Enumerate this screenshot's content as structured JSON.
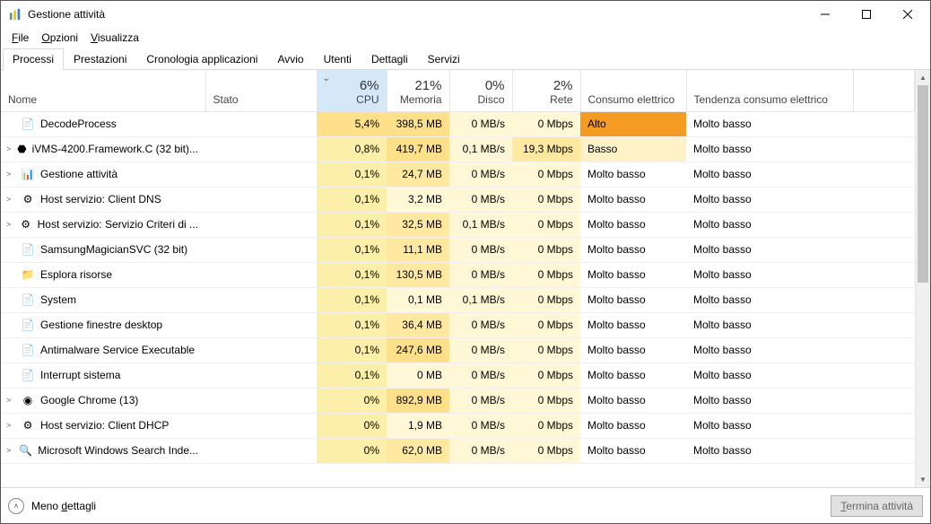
{
  "window": {
    "title": "Gestione attività"
  },
  "menu": {
    "file": "File",
    "options": "Opzioni",
    "view": "Visualizza"
  },
  "tabs": [
    "Processi",
    "Prestazioni",
    "Cronologia applicazioni",
    "Avvio",
    "Utenti",
    "Dettagli",
    "Servizi"
  ],
  "active_tab": 0,
  "columns": {
    "name": "Nome",
    "state": "Stato",
    "cpu": {
      "pct": "6%",
      "label": "CPU"
    },
    "mem": {
      "pct": "21%",
      "label": "Memoria"
    },
    "disk": {
      "pct": "0%",
      "label": "Disco"
    },
    "net": {
      "pct": "2%",
      "label": "Rete"
    },
    "power": "Consumo elettrico",
    "trend": "Tendenza consumo elettrico"
  },
  "rows": [
    {
      "exp": "",
      "icon": "app",
      "name": "DecodeProcess",
      "cpu": "5,4%",
      "mem": "398,5 MB",
      "disk": "0 MB/s",
      "net": "0 Mbps",
      "power": "Alto",
      "trend": "Molto basso",
      "pc": "alto"
    },
    {
      "exp": ">",
      "icon": "hik",
      "name": "iVMS-4200.Framework.C (32 bit)...",
      "cpu": "0,8%",
      "mem": "419,7 MB",
      "disk": "0,1 MB/s",
      "net": "19,3 Mbps",
      "power": "Basso",
      "trend": "Molto basso",
      "pc": "basso"
    },
    {
      "exp": ">",
      "icon": "tm",
      "name": "Gestione attività",
      "cpu": "0,1%",
      "mem": "24,7 MB",
      "disk": "0 MB/s",
      "net": "0 Mbps",
      "power": "Molto basso",
      "trend": "Molto basso",
      "pc": ""
    },
    {
      "exp": ">",
      "icon": "svc",
      "name": "Host servizio: Client DNS",
      "cpu": "0,1%",
      "mem": "3,2 MB",
      "disk": "0 MB/s",
      "net": "0 Mbps",
      "power": "Molto basso",
      "trend": "Molto basso",
      "pc": ""
    },
    {
      "exp": ">",
      "icon": "svc",
      "name": "Host servizio: Servizio Criteri di ...",
      "cpu": "0,1%",
      "mem": "32,5 MB",
      "disk": "0,1 MB/s",
      "net": "0 Mbps",
      "power": "Molto basso",
      "trend": "Molto basso",
      "pc": ""
    },
    {
      "exp": "",
      "icon": "app",
      "name": "SamsungMagicianSVC (32 bit)",
      "cpu": "0,1%",
      "mem": "11,1 MB",
      "disk": "0 MB/s",
      "net": "0 Mbps",
      "power": "Molto basso",
      "trend": "Molto basso",
      "pc": ""
    },
    {
      "exp": "",
      "icon": "folder",
      "name": "Esplora risorse",
      "cpu": "0,1%",
      "mem": "130,5 MB",
      "disk": "0 MB/s",
      "net": "0 Mbps",
      "power": "Molto basso",
      "trend": "Molto basso",
      "pc": ""
    },
    {
      "exp": "",
      "icon": "app",
      "name": "System",
      "cpu": "0,1%",
      "mem": "0,1 MB",
      "disk": "0,1 MB/s",
      "net": "0 Mbps",
      "power": "Molto basso",
      "trend": "Molto basso",
      "pc": ""
    },
    {
      "exp": "",
      "icon": "app",
      "name": "Gestione finestre desktop",
      "cpu": "0,1%",
      "mem": "36,4 MB",
      "disk": "0 MB/s",
      "net": "0 Mbps",
      "power": "Molto basso",
      "trend": "Molto basso",
      "pc": ""
    },
    {
      "exp": "",
      "icon": "app",
      "name": "Antimalware Service Executable",
      "cpu": "0,1%",
      "mem": "247,6 MB",
      "disk": "0 MB/s",
      "net": "0 Mbps",
      "power": "Molto basso",
      "trend": "Molto basso",
      "pc": ""
    },
    {
      "exp": "",
      "icon": "app",
      "name": "Interrupt sistema",
      "cpu": "0,1%",
      "mem": "0 MB",
      "disk": "0 MB/s",
      "net": "0 Mbps",
      "power": "Molto basso",
      "trend": "Molto basso",
      "pc": ""
    },
    {
      "exp": ">",
      "icon": "chrome",
      "name": "Google Chrome (13)",
      "cpu": "0%",
      "mem": "892,9 MB",
      "disk": "0 MB/s",
      "net": "0 Mbps",
      "power": "Molto basso",
      "trend": "Molto basso",
      "pc": ""
    },
    {
      "exp": ">",
      "icon": "svc",
      "name": "Host servizio: Client DHCP",
      "cpu": "0%",
      "mem": "1,9 MB",
      "disk": "0 MB/s",
      "net": "0 Mbps",
      "power": "Molto basso",
      "trend": "Molto basso",
      "pc": ""
    },
    {
      "exp": ">",
      "icon": "search",
      "name": "Microsoft Windows Search Inde...",
      "cpu": "0%",
      "mem": "62,0 MB",
      "disk": "0 MB/s",
      "net": "0 Mbps",
      "power": "Molto basso",
      "trend": "Molto basso",
      "pc": ""
    }
  ],
  "footer": {
    "fewer": "Meno dettagli",
    "end": "Termina attività"
  },
  "icons": {
    "app": "📄",
    "hik": "⬣",
    "tm": "📊",
    "svc": "⚙",
    "folder": "📁",
    "chrome": "◉",
    "search": "🔍"
  },
  "colors": {
    "accent": "#d5e8f8",
    "highlight_alto": "#f59a23"
  }
}
